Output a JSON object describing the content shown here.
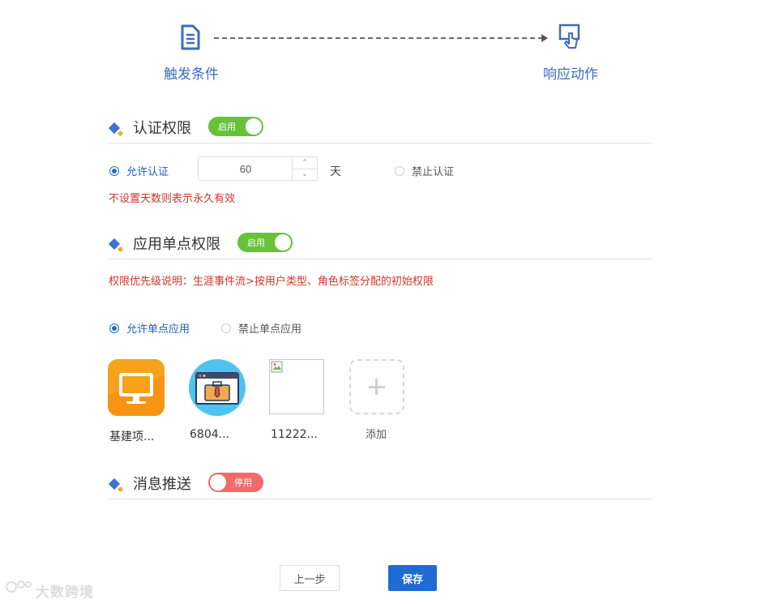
{
  "steps": {
    "trigger_label": "触发条件",
    "action_label": "响应动作"
  },
  "auth": {
    "title": "认证权限",
    "switch_text": "启用",
    "allow_label": "允许认证",
    "days_value": "60",
    "days_unit": "天",
    "deny_label": "禁止认证",
    "hint": "不设置天数则表示永久有效"
  },
  "sso": {
    "title": "应用单点权限",
    "switch_text": "启用",
    "priority_note": "权限优先级说明：生涯事件流>按用户类型、角色标签分配的初始权限",
    "allow_label": "允许单点应用",
    "deny_label": "禁止单点应用",
    "apps": [
      {
        "label": "基建项...",
        "icon": "monitor-icon",
        "color": "#f7a21b"
      },
      {
        "label": "6804...",
        "icon": "briefcase-window-icon",
        "color": "#4fc3f0"
      },
      {
        "label": "11222...",
        "icon": "broken-image-icon"
      }
    ],
    "add_label": "添加"
  },
  "push": {
    "title": "消息推送",
    "switch_text": "停用"
  },
  "footer": {
    "prev_label": "上一步",
    "save_label": "保存"
  },
  "watermark": "大数跨境",
  "colors": {
    "primary": "#1f6bd4",
    "switch_on": "#67c23a",
    "switch_off": "#f06b6b",
    "hint_red": "#d0362b"
  }
}
